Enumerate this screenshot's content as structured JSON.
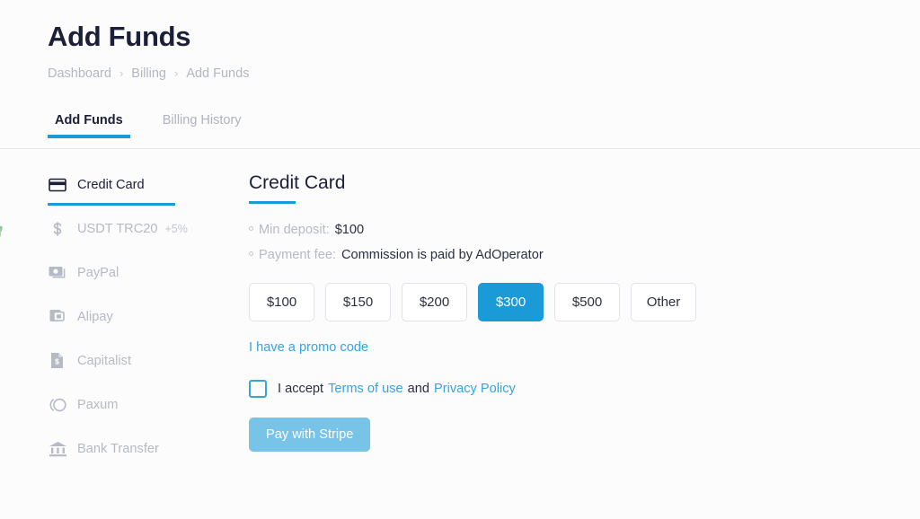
{
  "header": {
    "title": "Add Funds",
    "breadcrumb": [
      {
        "label": "Dashboard"
      },
      {
        "label": "Billing"
      },
      {
        "label": "Add Funds"
      }
    ],
    "separator": "›"
  },
  "tabs": [
    {
      "label": "Add Funds",
      "active": true
    },
    {
      "label": "Billing History",
      "active": false
    }
  ],
  "methods": [
    {
      "label": "Credit Card",
      "icon": "credit-card-icon",
      "bonus": "",
      "active": true
    },
    {
      "label": "USDT TRC20",
      "icon": "dollar-icon",
      "bonus": "+5%",
      "active": false
    },
    {
      "label": "PayPal",
      "icon": "paypal-icon",
      "bonus": "",
      "active": false
    },
    {
      "label": "Alipay",
      "icon": "alipay-icon",
      "bonus": "",
      "active": false
    },
    {
      "label": "Capitalist",
      "icon": "capitalist-icon",
      "bonus": "",
      "active": false
    },
    {
      "label": "Paxum",
      "icon": "paxum-icon",
      "bonus": "",
      "active": false
    },
    {
      "label": "Bank Transfer",
      "icon": "bank-icon",
      "bonus": "",
      "active": false
    }
  ],
  "promo_badge_icon": "percent-badge-icon",
  "panel": {
    "title": "Credit Card",
    "info": [
      {
        "label": "Min deposit:",
        "value": "$100"
      },
      {
        "label": "Payment fee:",
        "value": "Commission is paid by AdOperator"
      }
    ],
    "amounts": [
      {
        "label": "$100",
        "selected": false
      },
      {
        "label": "$150",
        "selected": false
      },
      {
        "label": "$200",
        "selected": false
      },
      {
        "label": "$300",
        "selected": true
      },
      {
        "label": "$500",
        "selected": false
      },
      {
        "label": "Other",
        "selected": false
      }
    ],
    "promo_link": "I have a promo code",
    "accept": {
      "prefix": "I accept",
      "terms_link": "Terms of use",
      "conjunction": "and",
      "privacy_link": "Privacy Policy",
      "checked": false
    },
    "pay_button": "Pay with Stripe"
  },
  "colors": {
    "accent": "#1a9ad7",
    "link": "#36a4e0",
    "pay_button": "#78c3e8",
    "bonus_green": "#8cc78c",
    "muted": "#b6bac4",
    "text": "#1b1f38"
  }
}
